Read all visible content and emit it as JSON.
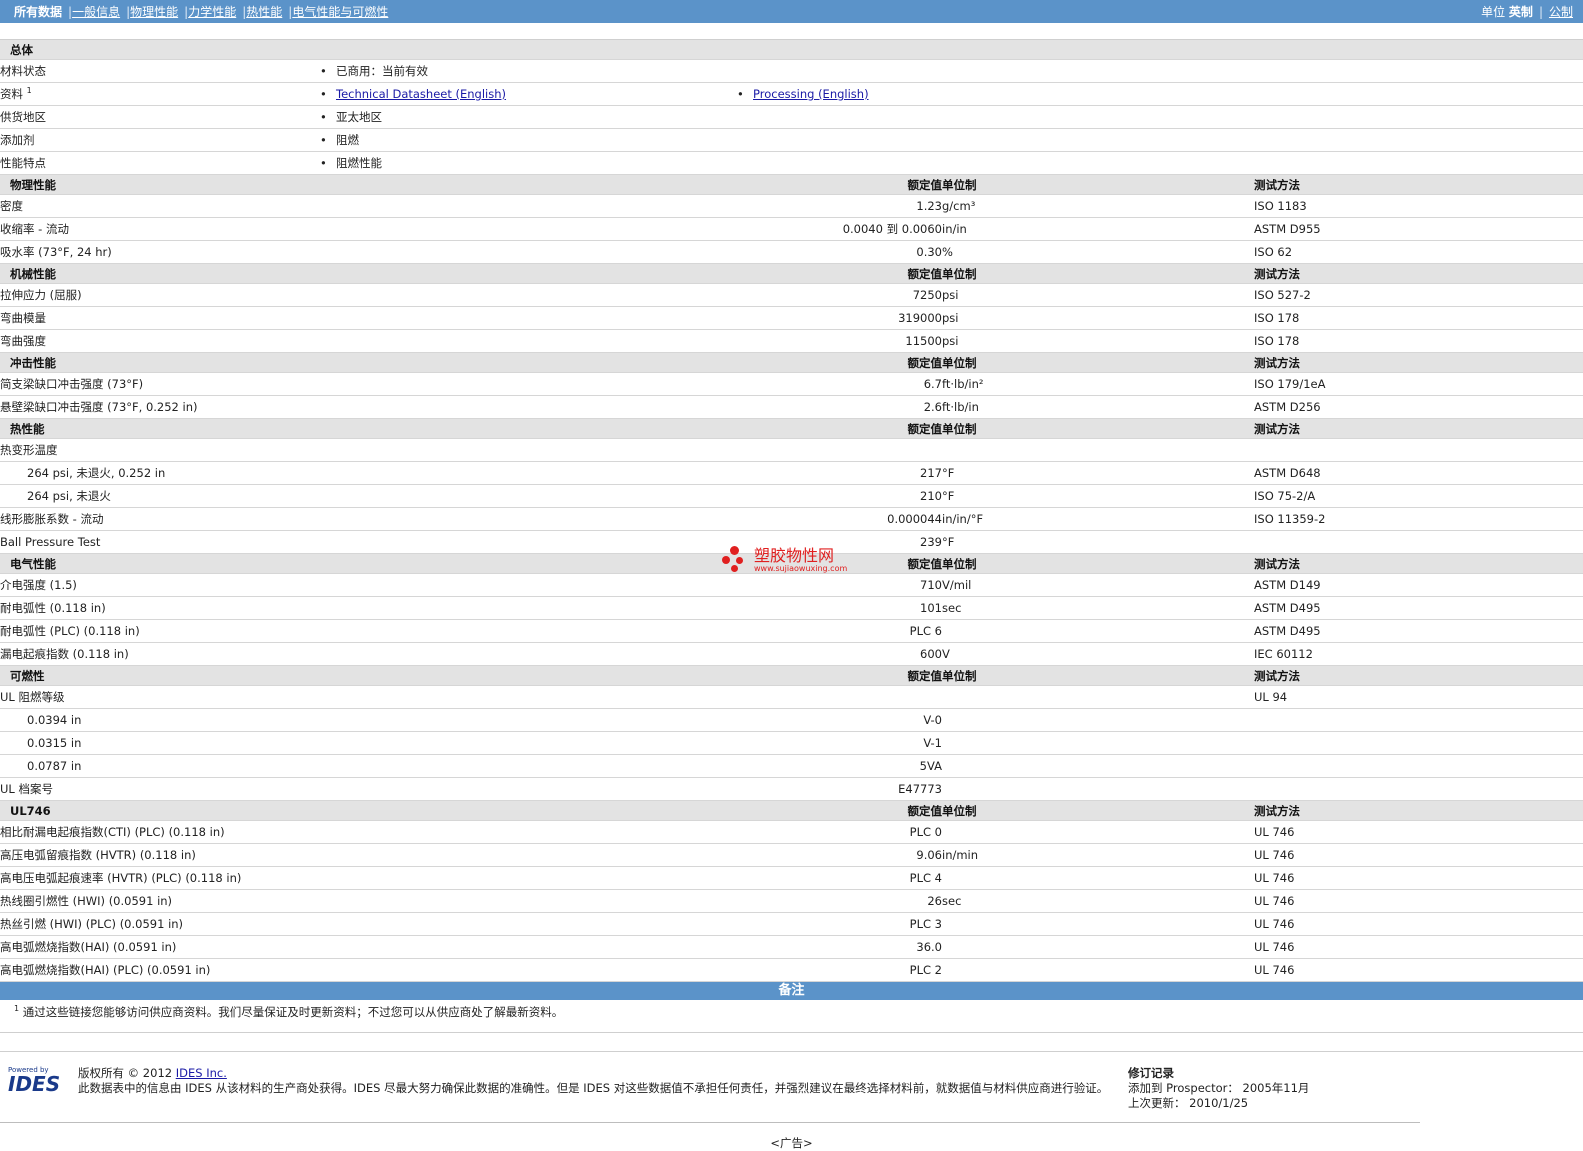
{
  "topbar": {
    "nav": [
      "所有数据",
      "一般信息",
      "物理性能",
      "力学性能",
      "热性能",
      "电气性能与可燃性"
    ],
    "unit_label": "单位",
    "unit_english": "英制",
    "unit_metric": "公制"
  },
  "headers": {
    "nominal": "额定值",
    "unit": "单位制",
    "test": "测试方法"
  },
  "general": {
    "title": "总体",
    "material_status": {
      "label": "材料状态",
      "value": "已商用：当前有效"
    },
    "literature": {
      "label": "资料",
      "sup": "1",
      "link1": "Technical Datasheet (English)",
      "link2": "Processing (English)"
    },
    "availability": {
      "label": "供货地区",
      "value": "亚太地区"
    },
    "additive": {
      "label": "添加剂",
      "value": "阻燃"
    },
    "features": {
      "label": "性能特点",
      "value": "阻燃性能"
    }
  },
  "sections": [
    {
      "title": "物理性能",
      "rows": [
        {
          "label": "密度",
          "value": "1.23",
          "unit": "g/cm³",
          "test": "ISO 1183"
        },
        {
          "label": "收缩率  - 流动",
          "value": "0.0040 到  0.0060",
          "unit": "in/in",
          "test": "ASTM D955"
        },
        {
          "label": "吸水率  (73°F, 24 hr)",
          "value": "0.30",
          "unit": "%",
          "test": "ISO 62"
        }
      ]
    },
    {
      "title": "机械性能",
      "rows": [
        {
          "label": "拉伸应力  (屈服)",
          "value": "7250",
          "unit": "psi",
          "test": "ISO 527-2"
        },
        {
          "label": "弯曲模量",
          "value": "319000",
          "unit": "psi",
          "test": "ISO 178"
        },
        {
          "label": "弯曲强度",
          "value": "11500",
          "unit": "psi",
          "test": "ISO 178"
        }
      ]
    },
    {
      "title": "冲击性能",
      "rows": [
        {
          "label": "简支梁缺口冲击强度  (73°F)",
          "value": "6.7",
          "unit": "ft·lb/in²",
          "test": "ISO 179/1eA"
        },
        {
          "label": "悬壁梁缺口冲击强度  (73°F, 0.252 in)",
          "value": "2.6",
          "unit": "ft·lb/in",
          "test": "ASTM D256"
        }
      ]
    },
    {
      "title": "热性能",
      "rows": [
        {
          "label": "热变形温度",
          "value": "",
          "unit": "",
          "test": ""
        },
        {
          "label": "264 psi, 未退火, 0.252 in",
          "value": "217",
          "unit": "°F",
          "test": "ASTM D648",
          "indent": true
        },
        {
          "label": "264 psi, 未退火",
          "value": "210",
          "unit": "°F",
          "test": "ISO 75-2/A",
          "indent": true
        },
        {
          "label": "线形膨胀系数  - 流动",
          "value": "0.000044",
          "unit": "in/in/°F",
          "test": "ISO 11359-2"
        },
        {
          "label": "Ball Pressure Test",
          "value": "239",
          "unit": "°F",
          "test": ""
        }
      ]
    },
    {
      "title": "电气性能",
      "rows": [
        {
          "label": "介电强度  (1.5)",
          "value": "710",
          "unit": "V/mil",
          "test": "ASTM D149"
        },
        {
          "label": "耐电弧性  (0.118 in)",
          "value": "101",
          "unit": "sec",
          "test": "ASTM D495"
        },
        {
          "label": "耐电弧性  (PLC) (0.118 in)",
          "value": "PLC 6",
          "unit": "",
          "test": "ASTM D495"
        },
        {
          "label": "漏电起痕指数  (0.118 in)",
          "value": "600",
          "unit": "V",
          "test": "IEC 60112"
        }
      ]
    },
    {
      "title": "可燃性",
      "rows": [
        {
          "label": "UL 阻燃等级",
          "value": "",
          "unit": "",
          "test": "UL 94"
        },
        {
          "label": "0.0394 in",
          "value": "V-0",
          "unit": "",
          "test": "",
          "indent": true
        },
        {
          "label": "0.0315 in",
          "value": "V-1",
          "unit": "",
          "test": "",
          "indent": true
        },
        {
          "label": "0.0787 in",
          "value": "5VA",
          "unit": "",
          "test": "",
          "indent": true
        },
        {
          "label": "UL 档案号",
          "value": "E47773",
          "unit": "",
          "test": ""
        }
      ]
    },
    {
      "title": "UL746",
      "rows": [
        {
          "label": "相比耐漏电起痕指数(CTI) (PLC) (0.118 in)",
          "value": "PLC 0",
          "unit": "",
          "test": "UL 746"
        },
        {
          "label": "高压电弧留痕指数  (HVTR) (0.118 in)",
          "value": "9.06",
          "unit": "in/min",
          "test": "UL 746"
        },
        {
          "label": "高电压电弧起痕速率  (HVTR) (PLC) (0.118 in)",
          "value": "PLC 4",
          "unit": "",
          "test": "UL 746"
        },
        {
          "label": "热线圈引燃性  (HWI) (0.0591 in)",
          "value": "26",
          "unit": "sec",
          "test": "UL 746"
        },
        {
          "label": "热丝引燃  (HWI) (PLC) (0.0591 in)",
          "value": "PLC 3",
          "unit": "",
          "test": "UL 746"
        },
        {
          "label": "高电弧燃烧指数(HAI) (0.0591 in)",
          "value": "36.0",
          "unit": "",
          "test": "UL 746"
        },
        {
          "label": "高电弧燃烧指数(HAI) (PLC) (0.0591 in)",
          "value": "PLC 2",
          "unit": "",
          "test": "UL 746"
        }
      ]
    }
  ],
  "notes": {
    "title": "备注",
    "sup": "1",
    "text": "通过这些链接您能够访问供应商资料。我们尽量保证及时更新资料；不过您可以从供应商处了解最新资料。"
  },
  "footer": {
    "logo_small": "Powered by",
    "logo_word": "IDES",
    "copyright": "版权所有  © 2012",
    "company_link": "IDES Inc.",
    "disclaimer": "此数据表中的信息由  IDES 从该材料的生产商处获得。IDES 尽最大努力确保此数据的准确性。但是  IDES 对这些数据值不承担任何责任，并强烈建议在最终选择材料前，就数据值与材料供应商进行验证。",
    "history_title": "修订记录",
    "added_label": "添加到  Prospector：",
    "added_value": "2005年11月",
    "updated_label": "上次更新：",
    "updated_value": "2010/1/25",
    "ad": "<广告>"
  },
  "watermark": {
    "name": "塑胶物性网",
    "url": "www.sujiaowuxing.com"
  }
}
